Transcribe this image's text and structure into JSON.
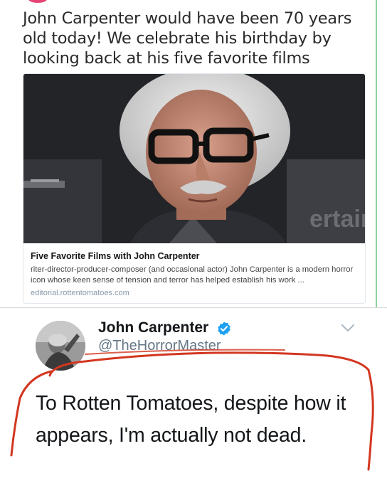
{
  "top_tweet": {
    "text": "John Carpenter would have been 70 years old today! We celebrate his birthday by looking back at his five favorite films",
    "card": {
      "title": "Five Favorite Films with John Carpenter",
      "description": "riter-director-producer-composer (and occasional actor) John Carpenter is a modern horror icon whose keen sense of tension and terror has helped establish his work ...",
      "domain": "editorial.rottentomatoes.com",
      "image_backdrop_text": "ertainment"
    }
  },
  "reply_tweet": {
    "author_name": "John Carpenter",
    "verified_icon": "verified-badge-icon",
    "author_handle": "@TheHorrorMaster",
    "menu_icon": "chevron-down-icon",
    "text": "To Rotten Tomatoes, despite how it appears, I'm actually not dead."
  },
  "colors": {
    "verified_blue": "#1da1f2",
    "annotation_red": "#d3361f",
    "handle_gray": "#657786",
    "link_domain": "#8a9aa8"
  }
}
